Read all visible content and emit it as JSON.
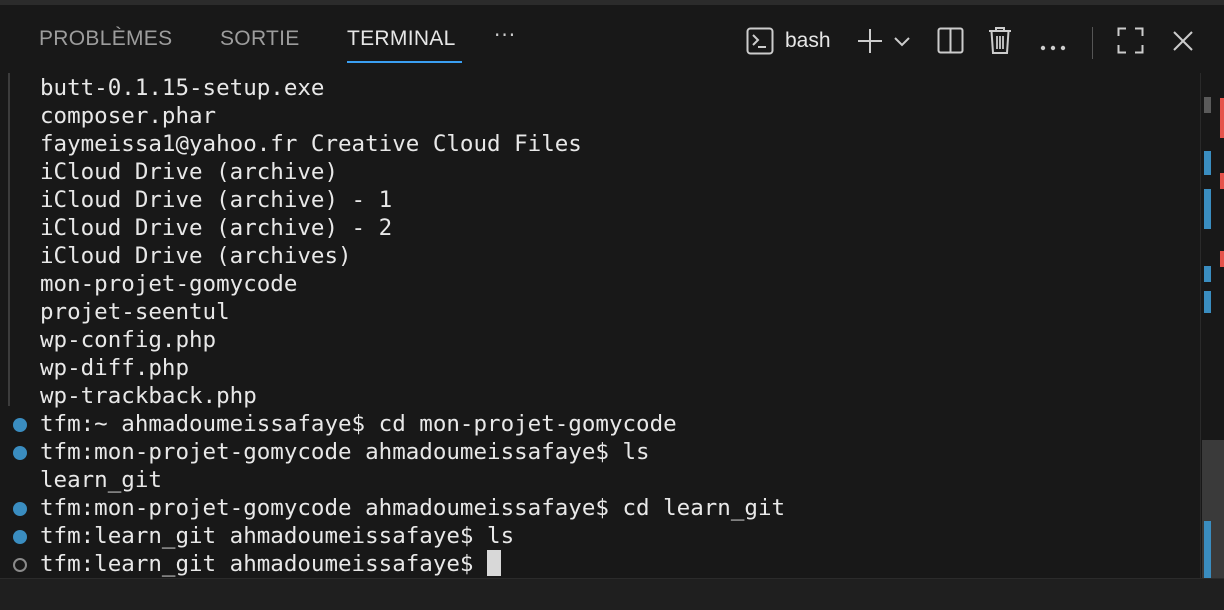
{
  "tabs": [
    {
      "label": "PROBLÈMES"
    },
    {
      "label": "SORTIE"
    },
    {
      "label": "TERMINAL"
    }
  ],
  "tab_more_label": "···",
  "terminal_profile": {
    "label": "bash"
  },
  "icons": {
    "terminal_profile": "terminal-icon",
    "new_terminal": "plus-icon",
    "dropdown": "chevron-down-icon",
    "split": "split-icon",
    "kill": "trash-icon",
    "more": "ellipsis-icon",
    "maximize": "maximize-icon",
    "close": "close-icon"
  },
  "colors": {
    "background": "#181818",
    "active_tab_underline": "#3a9ff2",
    "success_decoration": "#3a8dc0",
    "scrollbar_error_mark": "#e5534b",
    "scrollbar_info_mark": "#3a8dc0"
  },
  "output_lines": [
    "butt-0.1.15-setup.exe",
    "composer.phar",
    "faymeissa1@yahoo.fr Creative Cloud Files",
    "iCloud Drive (archive)",
    "iCloud Drive (archive) - 1",
    "iCloud Drive (archive) - 2",
    "iCloud Drive (archives)",
    "mon-projet-gomycode",
    "projet-seentul",
    "wp-config.php",
    "wp-diff.php",
    "wp-trackback.php"
  ],
  "commands": [
    {
      "prompt": "tfm:~ ahmadoumeissafaye$ cd mon-projet-gomycode",
      "output": ""
    },
    {
      "prompt": "tfm:mon-projet-gomycode ahmadoumeissafaye$ ls",
      "output": "learn_git"
    },
    {
      "prompt": "tfm:mon-projet-gomycode ahmadoumeissafaye$ cd learn_git",
      "output": ""
    },
    {
      "prompt": "tfm:learn_git ahmadoumeissafaye$ ls",
      "output": ""
    }
  ],
  "current_prompt": "tfm:learn_git ahmadoumeissafaye$"
}
